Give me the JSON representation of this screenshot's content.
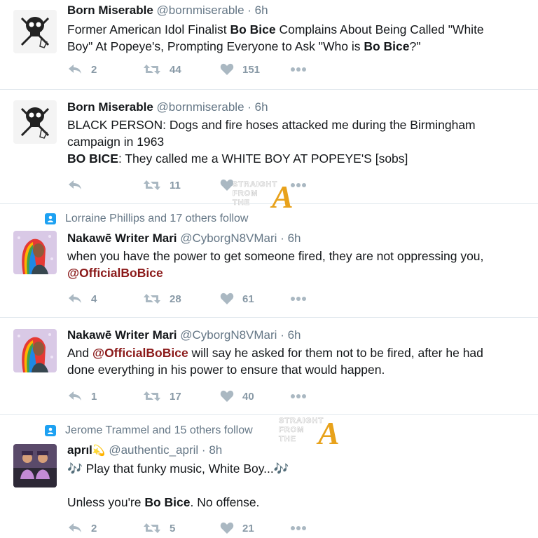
{
  "watermark": {
    "line1": "STRAIGHT",
    "line2": "FROM",
    "line3": "THE",
    "letter": "A"
  },
  "tweets": [
    {
      "social": "",
      "name": "Born Miserable",
      "handle": "@bornmiserable",
      "dot": "·",
      "time": "6h",
      "text_parts": [
        "Former American Idol Finalist ",
        "Bo Bice",
        " Complains About Being Called \"White",
        "Boy\" At Popeye's, Prompting Everyone to Ask \"Who is ",
        "Bo Bice",
        "?\""
      ],
      "reply_count": "2",
      "retweet_count": "44",
      "like_count": "151"
    },
    {
      "social": "",
      "name": "Born Miserable",
      "handle": "@bornmiserable",
      "dot": "·",
      "time": "6h",
      "text_parts": [
        "BLACK PERSON: Dogs and fire hoses attacked me during the Birmingham",
        "campaign in 1963",
        "BO BICE",
        ": They called me a WHITE BOY AT POPEYE'S [sobs]"
      ],
      "reply_count": "",
      "retweet_count": "11",
      "like_count": ""
    },
    {
      "social": "Lorraine Phillips and 17 others follow",
      "name": "Nakawē Writer Mari",
      "handle": "@CyborgN8VMari",
      "dot": "·",
      "time": "6h",
      "text_parts": [
        "when you have the power to get someone fired, they are not oppressing you,",
        "@OfficialBoBice"
      ],
      "reply_count": "4",
      "retweet_count": "28",
      "like_count": "61"
    },
    {
      "social": "",
      "name": "Nakawē Writer Mari",
      "handle": "@CyborgN8VMari",
      "dot": "·",
      "time": "6h",
      "text_parts": [
        "And ",
        "@OfficialBoBice",
        " will say he asked for them not to be fired, after he had",
        "done everything in his power to ensure that would happen."
      ],
      "reply_count": "1",
      "retweet_count": "17",
      "like_count": "40"
    },
    {
      "social": "Jerome Trammel and 15 others follow",
      "name": "aprıl",
      "name_emoji": "💫",
      "handle": "@authentic_april",
      "dot": "·",
      "time": "8h",
      "text_parts": [
        "🎶",
        " Play that funky music, White Boy...",
        "🎶",
        "Unless you're ",
        "Bo Bice",
        ". No offense."
      ],
      "reply_count": "2",
      "retweet_count": "5",
      "like_count": "21"
    }
  ],
  "icons": {
    "reply": "reply-icon",
    "retweet": "retweet-icon",
    "like": "heart-icon",
    "more": "more-icon",
    "follow": "person-icon"
  },
  "colors": {
    "icon_gray": "#aab8c2",
    "link_red": "#8b1a1a",
    "follow_blue": "#1da1f2",
    "watermark_gold": "#e8a21b"
  }
}
